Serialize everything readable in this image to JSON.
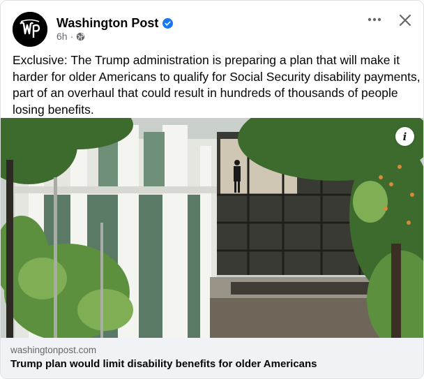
{
  "post": {
    "page_name": "Washington Post",
    "verified_icon": "verified-badge-icon",
    "time": "6h",
    "separator": "·",
    "privacy_icon": "globe-icon",
    "text": "Exclusive: The Trump administration is preparing a plan that will make it harder for older Americans to qualify for Social Security disability payments, part of an overhaul that could result in hundreds of thousands of people losing benefits.",
    "more_icon": "more-options-icon",
    "close_icon": "close-icon"
  },
  "link_preview": {
    "domain": "washingtonpost.com",
    "headline": "Trump plan would limit disability benefits for older Americans",
    "info_label": "i"
  },
  "colors": {
    "brand": "#000000",
    "verified": "#1877f2",
    "secondary_text": "#65676b",
    "footer_bg": "#f0f2f5"
  }
}
